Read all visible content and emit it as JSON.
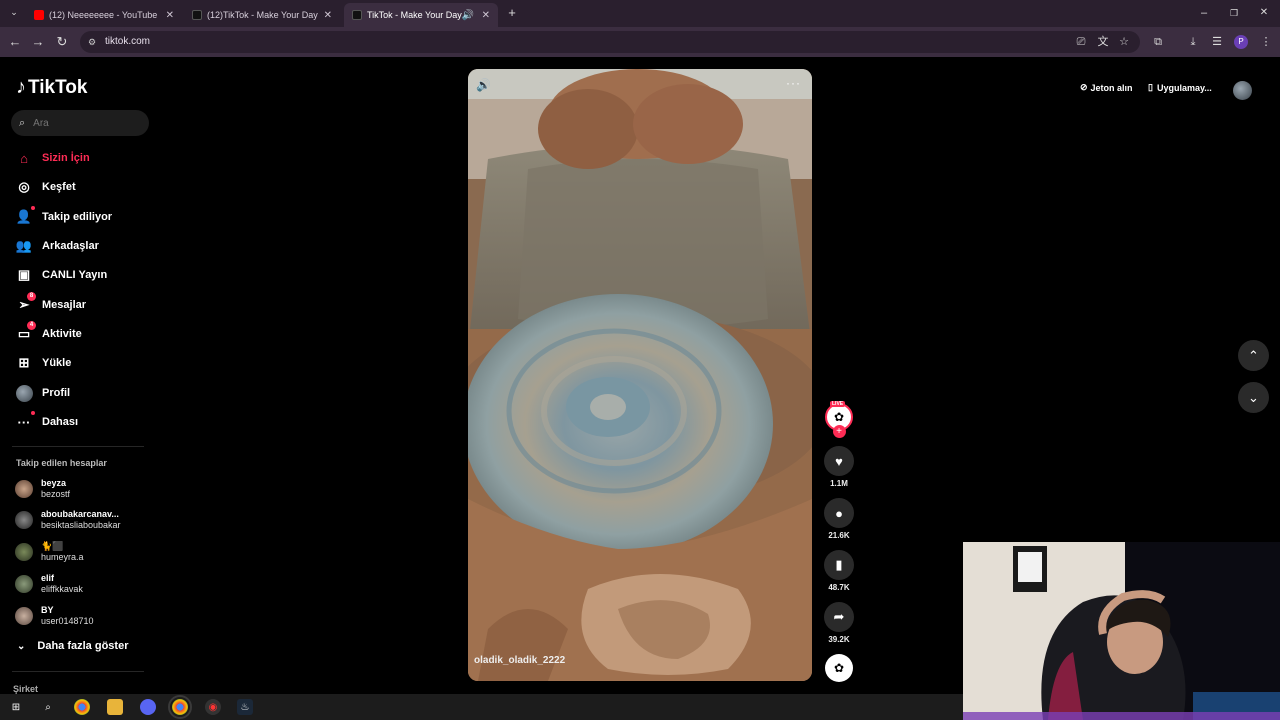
{
  "browser": {
    "tabs": [
      {
        "label": "(12) Neeeeeeee - YouTube",
        "favicon_color": "#ff0000"
      },
      {
        "label": "(12)TikTok - Make Your Day",
        "favicon_color": "#000000"
      },
      {
        "label": "TikTok - Make Your Day",
        "favicon_color": "#000000"
      }
    ],
    "url": "tiktok.com",
    "profile_letter": "P"
  },
  "sidebar": {
    "logo_text": "TikTok",
    "search_placeholder": "Ara",
    "nav": [
      {
        "label": "Sizin İçin",
        "icon": "home-icon"
      },
      {
        "label": "Keşfet",
        "icon": "compass-icon"
      },
      {
        "label": "Takip ediliyor",
        "icon": "following-icon"
      },
      {
        "label": "Arkadaşlar",
        "icon": "friends-icon"
      },
      {
        "label": "CANLI Yayın",
        "icon": "live-icon"
      },
      {
        "label": "Mesajlar",
        "icon": "messages-icon",
        "badge": "8"
      },
      {
        "label": "Aktivite",
        "icon": "activity-icon",
        "badge": "4"
      },
      {
        "label": "Yükle",
        "icon": "upload-icon"
      },
      {
        "label": "Profil",
        "icon": "profile-avatar"
      },
      {
        "label": "Dahası",
        "icon": "more-icon"
      }
    ],
    "following_title": "Takip edilen hesaplar",
    "accounts": [
      {
        "name": "beyza",
        "handle": "bezostf"
      },
      {
        "name": "aboubakarcanav...",
        "handle": "besiktasliaboubakar"
      },
      {
        "name": "🐈⬛",
        "handle": "humeyra.a"
      },
      {
        "name": "elif",
        "handle": "eliffkkavak"
      },
      {
        "name": "BY",
        "handle": "user0148710"
      }
    ],
    "show_more": "Daha fazla göster",
    "company": "Şirket"
  },
  "video": {
    "author": "oladik_oladik_2222",
    "live_badge": "LIVE",
    "likes": "1.1M",
    "comments": "21.6K",
    "saves": "48.7K",
    "shares": "39.2K"
  },
  "topright": {
    "coins": "Jeton alın",
    "app": "Uygulamay..."
  }
}
